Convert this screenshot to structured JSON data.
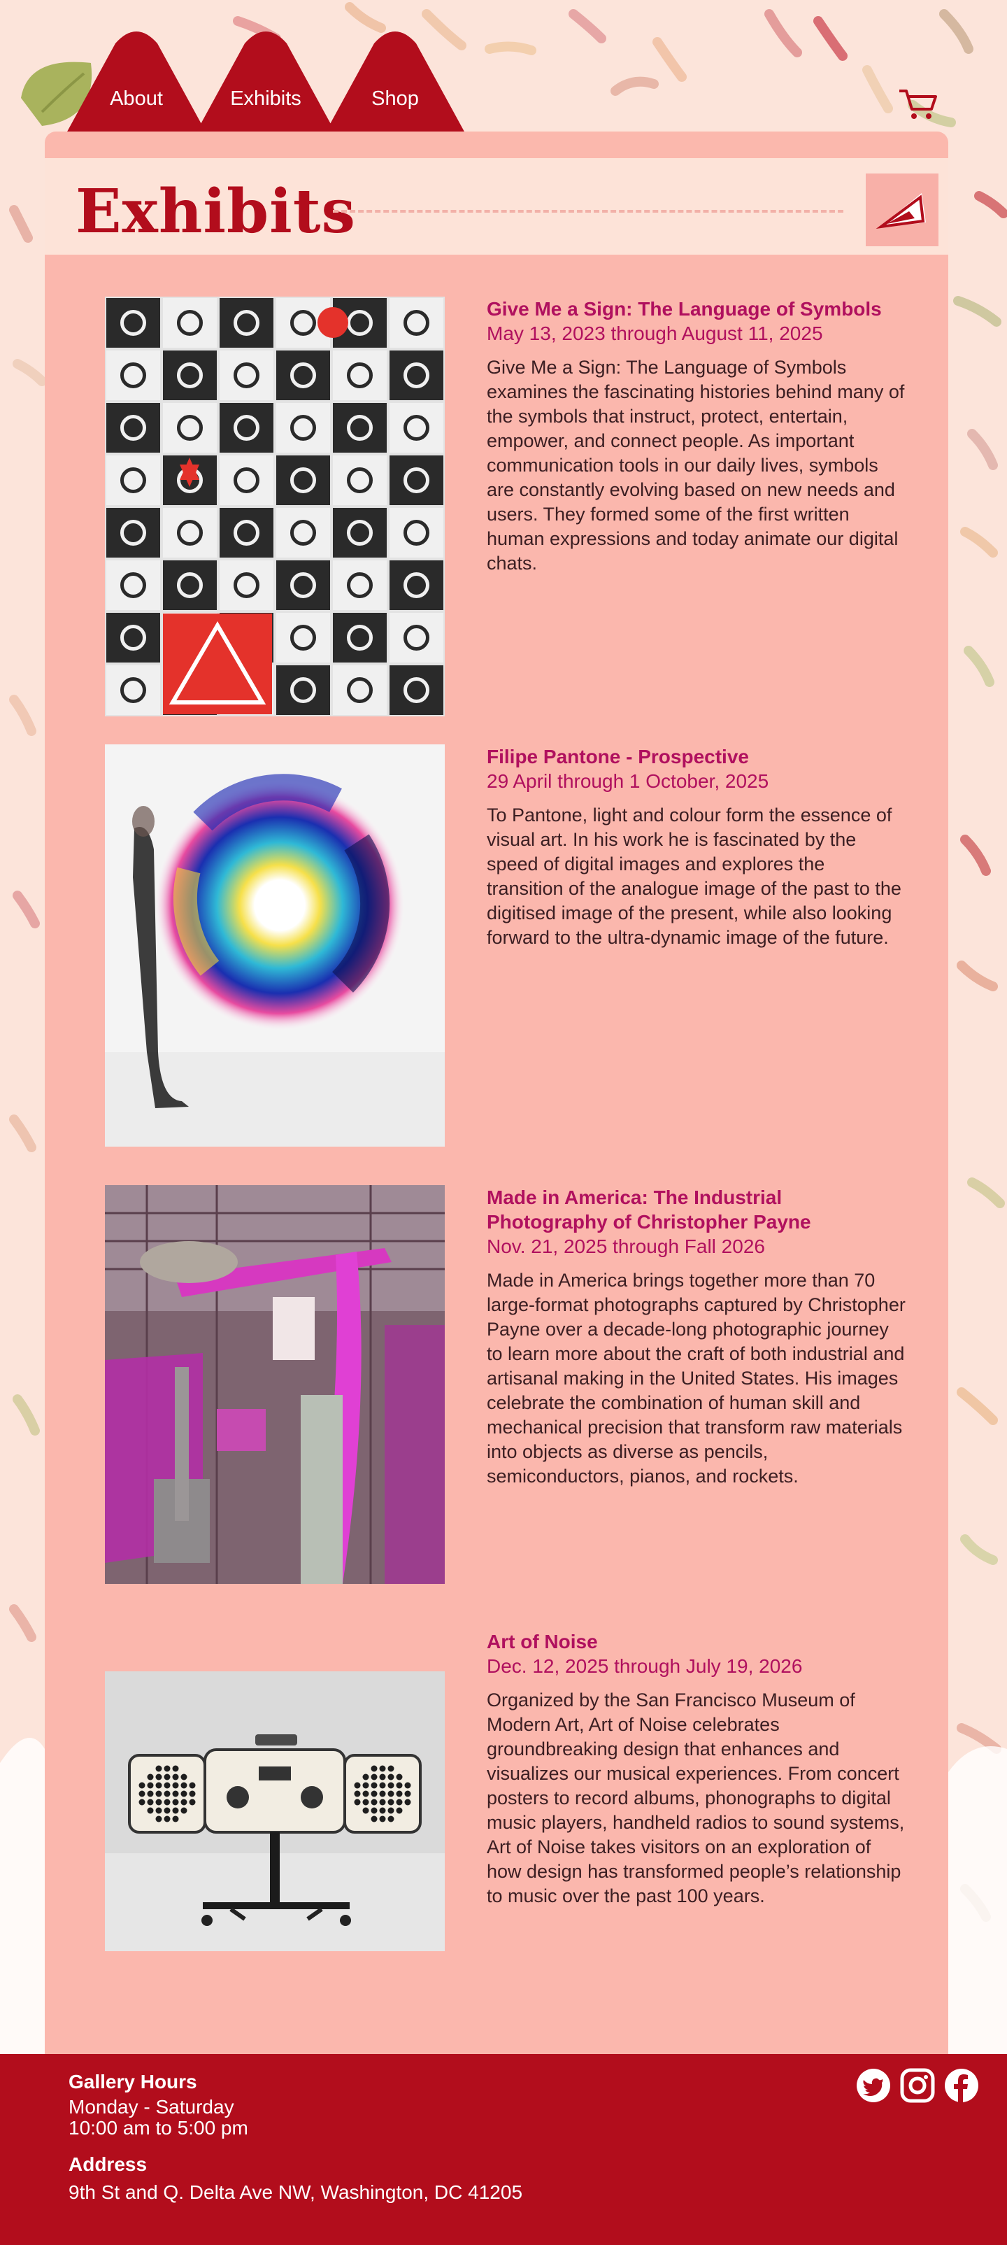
{
  "nav": {
    "items": [
      {
        "label": "About"
      },
      {
        "label": "Exhibits"
      },
      {
        "label": "Shop"
      }
    ],
    "cart_icon": "shopping-cart-icon",
    "leaf_icon": "leaf-decoration"
  },
  "header": {
    "title": "Exhibits",
    "action_icon": "pyramid-icon"
  },
  "exhibits": [
    {
      "title": "Give Me a Sign: The Language of Symbols",
      "dates": "May 13, 2023 through August 11, 2025",
      "description": "Give Me a Sign: The Language of Symbols examines the fascinating histories behind many of the symbols that instruct, protect, entertain, empower, and connect people. As important communication tools in our daily lives, symbols are constantly evolving based on new needs and users. They formed some of the first written human expressions and today animate our digital chats.",
      "image": "symbols-grid-photo"
    },
    {
      "title": "Filipe Pantone - Prospective",
      "dates": "29 April through 1 October, 2025",
      "description": "To Pantone, light and colour form the essence of visual art. In his work he is fascinated by the speed of digital images and explores the transition of the analogue image of the past to the digitised image of the present, while also looking forward to the ultra-dynamic image of the future.",
      "image": "rainbow-disc-artwork-photo"
    },
    {
      "title": "Made in America: The Industrial Photography of Christopher Payne",
      "dates": "Nov. 21, 2025 through Fall 2026",
      "description": "Made in America brings together more than 70 large-format photographs captured by Christopher Payne over a decade-long photographic journey to learn more about the craft of both industrial and artisanal making in the United States. His images celebrate the combination of human skill and mechanical precision that transform raw materials into objects as diverse as pencils, semiconductors, pianos, and rockets.",
      "image": "magenta-factory-photo"
    },
    {
      "title": "Art of Noise",
      "dates": "Dec. 12, 2025 through July 19, 2026",
      "description": "Organized by the San Francisco Museum of Modern Art, Art of Noise celebrates groundbreaking design that enhances and visualizes our musical experiences. From concert posters to record albums, phonographs to digital music players, handheld radios to sound systems, Art of Noise takes visitors on an exploration of how design has transformed people’s relationship to music over the past 100 years.",
      "image": "radio-phonograph-photo"
    }
  ],
  "footer": {
    "hours_label": "Gallery Hours",
    "hours_days": "Monday - Saturday",
    "hours_time": "10:00 am to 5:00 pm",
    "address_label": "Address",
    "address": "9th St and Q. Delta Ave NW, Washington, DC 41205",
    "social": [
      "twitter-icon",
      "instagram-icon",
      "facebook-icon"
    ]
  },
  "colors": {
    "brand_red": "#b20d1c",
    "panel_pink": "#fbb7ad",
    "background": "#fce4da",
    "title_magenta": "#b0105e"
  }
}
